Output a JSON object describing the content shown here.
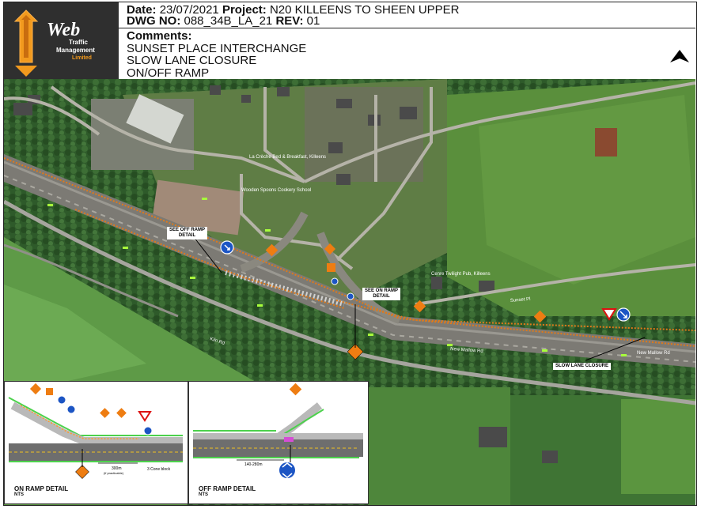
{
  "logo": {
    "line1": "Web",
    "line2": "Traffic",
    "line3": "Management",
    "line4": "Limited"
  },
  "header": {
    "date_label": "Date:",
    "date": "23/07/2021",
    "project_label": "Project:",
    "project": "N20 KILLEENS TO SHEEN UPPER",
    "dwg_label": "DWG NO:",
    "dwg": "088_34B_LA_21",
    "rev_label": "REV:",
    "rev": "01",
    "comments_label": "Comments:",
    "comments": [
      "SUNSET PLACE INTERCHANGE",
      "SLOW LANE CLOSURE",
      "ON/OFF RAMP"
    ]
  },
  "map_labels": {
    "off_ramp": "SEE OFF RAMP\nDETAIL",
    "on_ramp": "SEE ON RAMP\nDETAIL",
    "slow_lane": "SLOW LANE CLOSURE",
    "new_mallow_rd": "New Mallow Rd",
    "new_mallow_rd2": "New Mallow Rd",
    "kiln_rd": "Kiln Rd",
    "sunset_pl": "Sunset Pl",
    "place1": "La Crèche Bed & Breakfast, Killeens",
    "place2": "Wooden Spoons Cookery School",
    "place3": "Cenre Twilight Pub, Killeens"
  },
  "on_ramp_detail": {
    "title": "ON RAMP DETAIL",
    "nts": "NTS",
    "dist": "300m",
    "dist_note": "(if practicable)",
    "cone_note": "3 Cone block"
  },
  "off_ramp_detail": {
    "title": "OFF RAMP DETAIL",
    "nts": "NTS",
    "dist": "140-280m"
  },
  "colors": {
    "header_border": "#222222",
    "logo_bg": "#2f2f2f",
    "logo_orange": "#f29a1e",
    "sign_orange": "#ee7d12",
    "sign_blue": "#1c55c4"
  }
}
